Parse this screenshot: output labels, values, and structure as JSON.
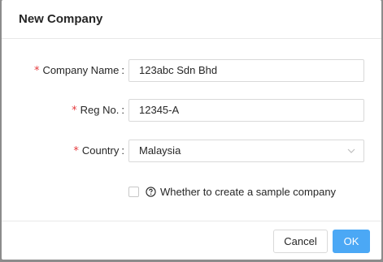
{
  "dialog": {
    "title": "New Company"
  },
  "form": {
    "company_name": {
      "required_mark": "*",
      "label": "Company Name",
      "colon": ":",
      "value": "123abc Sdn Bhd"
    },
    "reg_no": {
      "required_mark": "*",
      "label": "Reg No.",
      "colon": ":",
      "value": "12345-A"
    },
    "country": {
      "required_mark": "*",
      "label": "Country",
      "colon": ":",
      "selected": "Malaysia",
      "icon": "chevron-down-icon"
    },
    "sample_company": {
      "checked": false,
      "icon": "question-circle-icon",
      "label": "Whether to create a sample company"
    }
  },
  "footer": {
    "cancel_label": "Cancel",
    "ok_label": "OK"
  },
  "colors": {
    "primary": "#4ba8f5",
    "required": "#e4393c",
    "border": "#d9d9d9",
    "backdrop": "#8c8c8c"
  }
}
